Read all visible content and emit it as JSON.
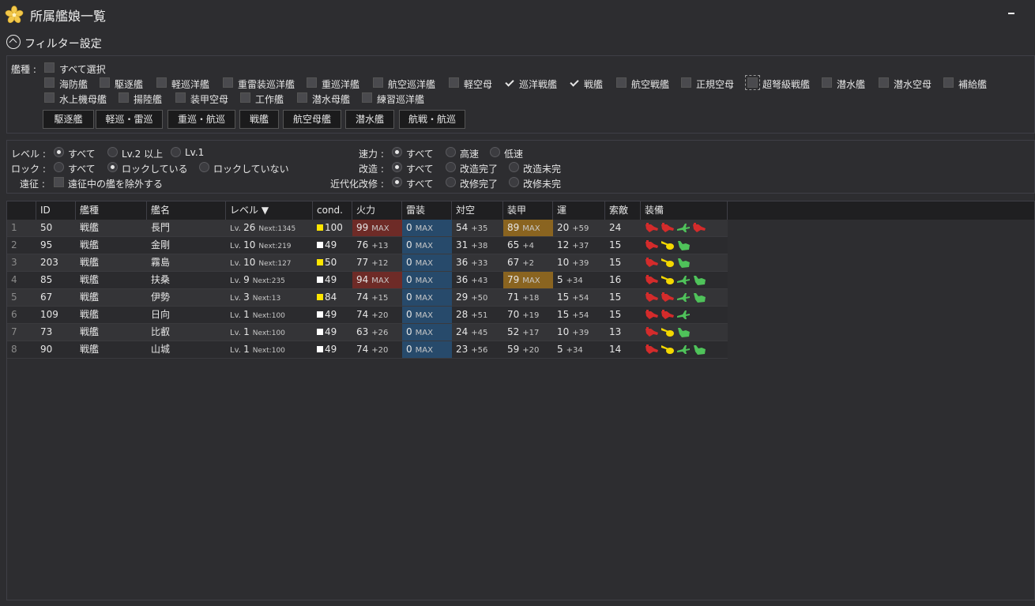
{
  "window": {
    "title": "所属艦娘一覧"
  },
  "filter": {
    "toggle_label": "フィルター設定",
    "ship_type_label": "艦種 :",
    "select_all": "すべて選択",
    "ship_types": [
      {
        "label": "海防艦",
        "checked": false
      },
      {
        "label": "駆逐艦",
        "checked": false
      },
      {
        "label": "軽巡洋艦",
        "checked": false
      },
      {
        "label": "重雷装巡洋艦",
        "checked": false
      },
      {
        "label": "重巡洋艦",
        "checked": false
      },
      {
        "label": "航空巡洋艦",
        "checked": false
      },
      {
        "label": "軽空母",
        "checked": false
      },
      {
        "label": "巡洋戦艦",
        "checked": true
      },
      {
        "label": "戦艦",
        "checked": true
      },
      {
        "label": "航空戦艦",
        "checked": false
      },
      {
        "label": "正規空母",
        "checked": false
      },
      {
        "label": "超弩級戦艦",
        "checked": false
      },
      {
        "label": "潜水艦",
        "checked": false
      },
      {
        "label": "潜水空母",
        "checked": false
      },
      {
        "label": "補給艦",
        "checked": false
      },
      {
        "label": "水上機母艦",
        "checked": false
      },
      {
        "label": "揚陸艦",
        "checked": false
      },
      {
        "label": "装甲空母",
        "checked": false
      },
      {
        "label": "工作艦",
        "checked": false
      },
      {
        "label": "潜水母艦",
        "checked": false
      },
      {
        "label": "練習巡洋艦",
        "checked": false
      }
    ],
    "preset_buttons": [
      "駆逐艦",
      "軽巡・雷巡",
      "重巡・航巡",
      "戦艦",
      "航空母艦",
      "潜水艦",
      "航戦・航巡"
    ],
    "level": {
      "label": "レベル :",
      "options": [
        "すべて",
        "Lv.2 以上",
        "Lv.1"
      ],
      "selected": 0
    },
    "lock": {
      "label": "ロック :",
      "options": [
        "すべて",
        "ロックしている",
        "ロックしていない"
      ],
      "selected": 1
    },
    "expedition": {
      "label": "遠征 :",
      "option": "遠征中の艦を除外する"
    },
    "speed": {
      "label": "速力 :",
      "options": [
        "すべて",
        "高速",
        "低速"
      ],
      "selected": 0
    },
    "remodel": {
      "label": "改造 :",
      "options": [
        "すべて",
        "改造完了",
        "改造未完"
      ],
      "selected": 0
    },
    "modernize": {
      "label": "近代化改修 :",
      "options": [
        "すべて",
        "改修完了",
        "改修未完"
      ],
      "selected": 0
    }
  },
  "table": {
    "columns": [
      "ID",
      "艦種",
      "艦名",
      "レベル ▼",
      "cond.",
      "火力",
      "雷装",
      "対空",
      "装甲",
      "運",
      "索敵",
      "装備"
    ],
    "max_label": "MAX",
    "lv_prefix": "Lv.",
    "next_prefix": "Next:",
    "colors": {
      "cond_yellow": "#ffe600",
      "cond_white": "#ffffff",
      "eq_red": "#d42b2b",
      "eq_yellow": "#f4d800",
      "eq_green": "#4fc25a",
      "max_fire": "#6e2b27",
      "torpedo": "#274a6b",
      "armor_max": "#8a6420"
    },
    "rows": [
      {
        "num": "1",
        "id": "50",
        "type": "戦艦",
        "name": "長門",
        "lv": "26",
        "next": "1345",
        "cond": "100",
        "cond_color": "yellow",
        "fire": "99",
        "fire_max": true,
        "torp": "0",
        "aa": "54",
        "aa_bonus": "+35",
        "armor": "89",
        "armor_max": true,
        "luck": "20",
        "luck_bonus": "+59",
        "los": "24",
        "equip": [
          "red-gun",
          "red-gun",
          "green-plane",
          "red-gun"
        ]
      },
      {
        "num": "2",
        "id": "95",
        "type": "戦艦",
        "name": "金剛",
        "lv": "10",
        "next": "219",
        "cond": "49",
        "cond_color": "white",
        "fire": "76",
        "fire_bonus": "+13",
        "torp": "0",
        "aa": "31",
        "aa_bonus": "+38",
        "armor": "65",
        "armor_bonus": "+4",
        "luck": "12",
        "luck_bonus": "+37",
        "los": "15",
        "equip": [
          "red-gun",
          "yellow-gun",
          "green-radar"
        ]
      },
      {
        "num": "3",
        "id": "203",
        "type": "戦艦",
        "name": "霧島",
        "lv": "10",
        "next": "127",
        "cond": "50",
        "cond_color": "yellow",
        "fire": "77",
        "fire_bonus": "+12",
        "torp": "0",
        "aa": "36",
        "aa_bonus": "+33",
        "armor": "67",
        "armor_bonus": "+2",
        "luck": "10",
        "luck_bonus": "+39",
        "los": "15",
        "equip": [
          "red-gun",
          "yellow-gun",
          "green-radar"
        ]
      },
      {
        "num": "4",
        "id": "85",
        "type": "戦艦",
        "name": "扶桑",
        "lv": "9",
        "next": "235",
        "cond": "49",
        "cond_color": "white",
        "fire": "94",
        "fire_max": true,
        "torp": "0",
        "aa": "36",
        "aa_bonus": "+43",
        "armor": "79",
        "armor_max": true,
        "luck": "5",
        "luck_bonus": "+34",
        "los": "16",
        "equip": [
          "red-gun",
          "yellow-gun",
          "green-plane",
          "green-radar"
        ]
      },
      {
        "num": "5",
        "id": "67",
        "type": "戦艦",
        "name": "伊勢",
        "lv": "3",
        "next": "13",
        "cond": "84",
        "cond_color": "yellow",
        "fire": "74",
        "fire_bonus": "+15",
        "torp": "0",
        "aa": "29",
        "aa_bonus": "+50",
        "armor": "71",
        "armor_bonus": "+18",
        "luck": "15",
        "luck_bonus": "+54",
        "los": "15",
        "equip": [
          "red-gun",
          "red-gun",
          "green-plane",
          "green-radar"
        ]
      },
      {
        "num": "6",
        "id": "109",
        "type": "戦艦",
        "name": "日向",
        "lv": "1",
        "next": "100",
        "cond": "49",
        "cond_color": "white",
        "fire": "74",
        "fire_bonus": "+20",
        "torp": "0",
        "aa": "28",
        "aa_bonus": "+51",
        "armor": "70",
        "armor_bonus": "+19",
        "luck": "15",
        "luck_bonus": "+54",
        "los": "15",
        "equip": [
          "red-gun",
          "red-gun",
          "green-plane"
        ]
      },
      {
        "num": "7",
        "id": "73",
        "type": "戦艦",
        "name": "比叡",
        "lv": "1",
        "next": "100",
        "cond": "49",
        "cond_color": "white",
        "fire": "63",
        "fire_bonus": "+26",
        "torp": "0",
        "aa": "24",
        "aa_bonus": "+45",
        "armor": "52",
        "armor_bonus": "+17",
        "luck": "10",
        "luck_bonus": "+39",
        "los": "13",
        "equip": [
          "red-gun",
          "yellow-gun",
          "green-radar"
        ]
      },
      {
        "num": "8",
        "id": "90",
        "type": "戦艦",
        "name": "山城",
        "lv": "1",
        "next": "100",
        "cond": "49",
        "cond_color": "white",
        "fire": "74",
        "fire_bonus": "+20",
        "torp": "0",
        "aa": "23",
        "aa_bonus": "+56",
        "armor": "59",
        "armor_bonus": "+20",
        "luck": "5",
        "luck_bonus": "+34",
        "los": "14",
        "equip": [
          "red-gun",
          "yellow-gun",
          "green-plane",
          "green-radar"
        ]
      }
    ]
  }
}
